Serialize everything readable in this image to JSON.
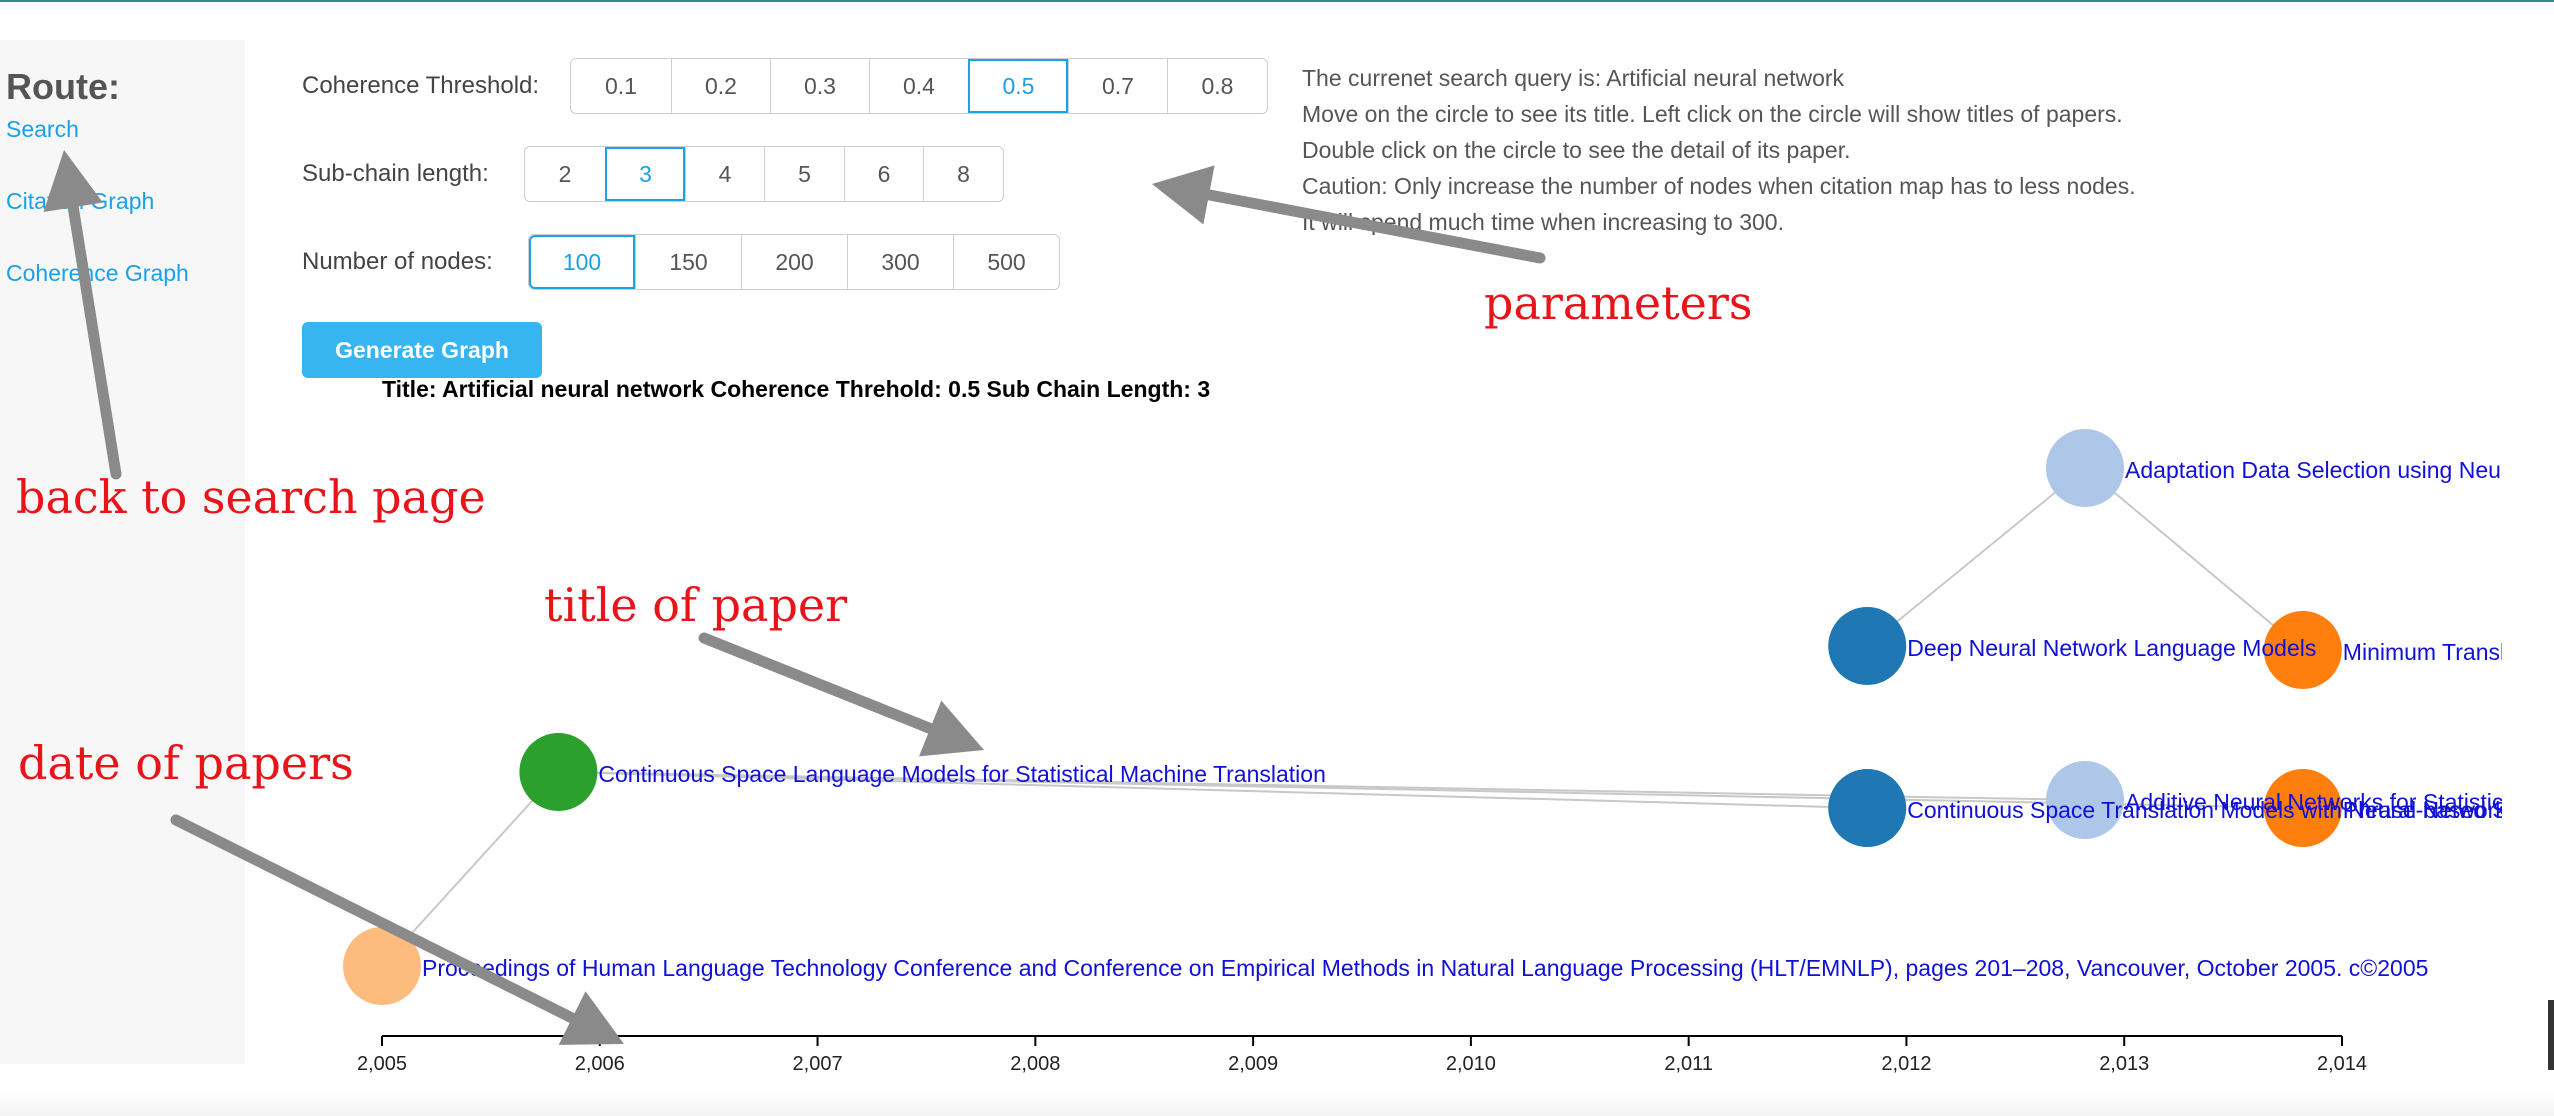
{
  "sidebar": {
    "title": "Route:",
    "links": [
      "Search",
      "Citation Graph",
      "Coherence Graph"
    ]
  },
  "params": {
    "coherence": {
      "label": "Coherence Threshold:",
      "options": [
        "0.1",
        "0.2",
        "0.3",
        "0.4",
        "0.5",
        "0.7",
        "0.8"
      ],
      "selected": "0.5"
    },
    "subchain": {
      "label": "Sub-chain length:",
      "options": [
        "2",
        "3",
        "4",
        "5",
        "6",
        "8"
      ],
      "selected": "3"
    },
    "nodes": {
      "label": "Number of nodes:",
      "options": [
        "100",
        "150",
        "200",
        "300",
        "500"
      ],
      "selected": "100"
    }
  },
  "generate_label": "Generate Graph",
  "graph_title": "Title: Artificial neural network Coherence Threhold: 0.5 Sub Chain Length: 3",
  "info_lines": [
    "The currenet search query is: Artificial neural network",
    "Move on the circle to see its title. Left click on the circle will show titles of papers.",
    "Double click on the circle to see the detail of its paper.",
    "Caution: Only increase the number of nodes when citation map has to less nodes.",
    "It will spend much time when increasing to 300."
  ],
  "graph": {
    "axis_ticks": [
      "2,005",
      "2,006",
      "2,007",
      "2,008",
      "2,009",
      "2,010",
      "2,011",
      "2,012",
      "2,013",
      "2,014"
    ],
    "nodes": [
      {
        "year": 2005.0,
        "color": "#fdbb7d",
        "label": "Proceedings of Human Language Technology Conference and Conference on Empirical Methods in Natural Language Processing (HLT/EMNLP), pages 201–208, Vancouver, October 2005. c©2005"
      },
      {
        "year": 2005.81,
        "color": "#2ca02c",
        "label": "Continuous Space Language Models for Statistical Machine Translation"
      },
      {
        "year": 2011.82,
        "color": "#1f77b4",
        "label": "Deep Neural Network Language Models"
      },
      {
        "year": 2011.82,
        "color": "#1f77b4",
        "label": "Continuous Space Translation Models with Neural Networks"
      },
      {
        "year": 2012.82,
        "color": "#aec7e8",
        "label": "Adaptation Data Selection using Neural Language Models"
      },
      {
        "year": 2012.82,
        "color": "#aec7e8",
        "label": "Additive Neural Networks for Statistical Machine Translation"
      },
      {
        "year": 2013.82,
        "color": "#ff7f0e",
        "label": "Minimum Translation Modeling with Recurrent Neural Networks"
      },
      {
        "year": 2013.82,
        "color": "#ff7f0e",
        "label": "Phrase-based Statistical Machine Translation"
      }
    ],
    "edges": [
      [
        0,
        1
      ],
      [
        1,
        3
      ],
      [
        1,
        5
      ],
      [
        1,
        7
      ],
      [
        2,
        4
      ],
      [
        4,
        6
      ]
    ]
  },
  "annotations": {
    "parameters": "parameters",
    "back": "back to search page",
    "title": "title of paper",
    "date": "date of papers"
  }
}
